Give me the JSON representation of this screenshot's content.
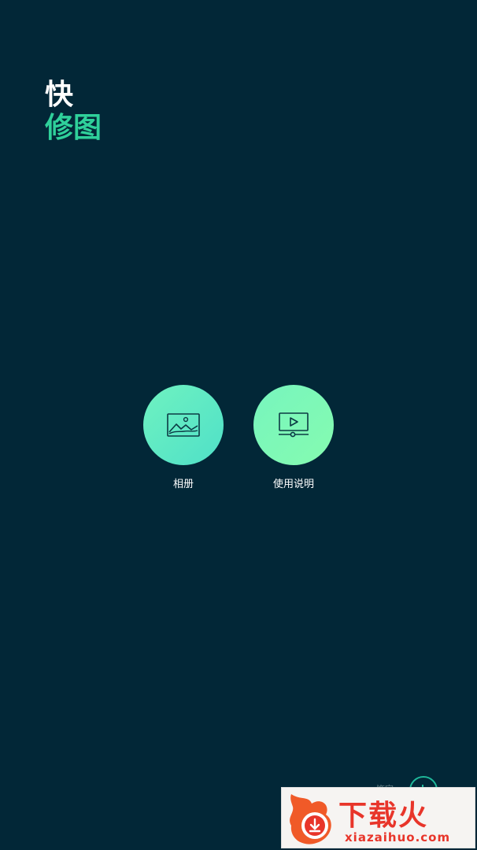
{
  "app": {
    "title_line1": "快",
    "title_line2": "修图",
    "accent_color": "#2fd09a",
    "background_color": "#022737"
  },
  "actions": [
    {
      "label": "相册",
      "icon": "picture-icon"
    },
    {
      "label": "使用说明",
      "icon": "video-play-icon"
    }
  ],
  "footer": {
    "partial_text": "饰字"
  },
  "watermark": {
    "title": "下载火",
    "url": "xiazaihuo.com"
  }
}
